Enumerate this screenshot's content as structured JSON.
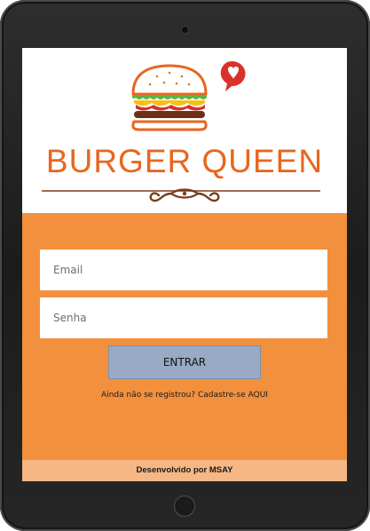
{
  "brand": {
    "name": "BURGER QUEEN",
    "accent_color": "#e8661f",
    "logo_icon": "burger-icon",
    "heart_icon": "heart-speech-bubble-icon"
  },
  "login": {
    "email_placeholder": "Email",
    "password_placeholder": "Senha",
    "submit_label": "ENTRAR",
    "register_text": "Ainda não se registrou? Cadastre-se AQUI",
    "background_color": "#f2903e",
    "button_color": "#98aac4"
  },
  "footer": {
    "text": "Desenvolvido por MSAY",
    "background_color": "#f6b784"
  }
}
